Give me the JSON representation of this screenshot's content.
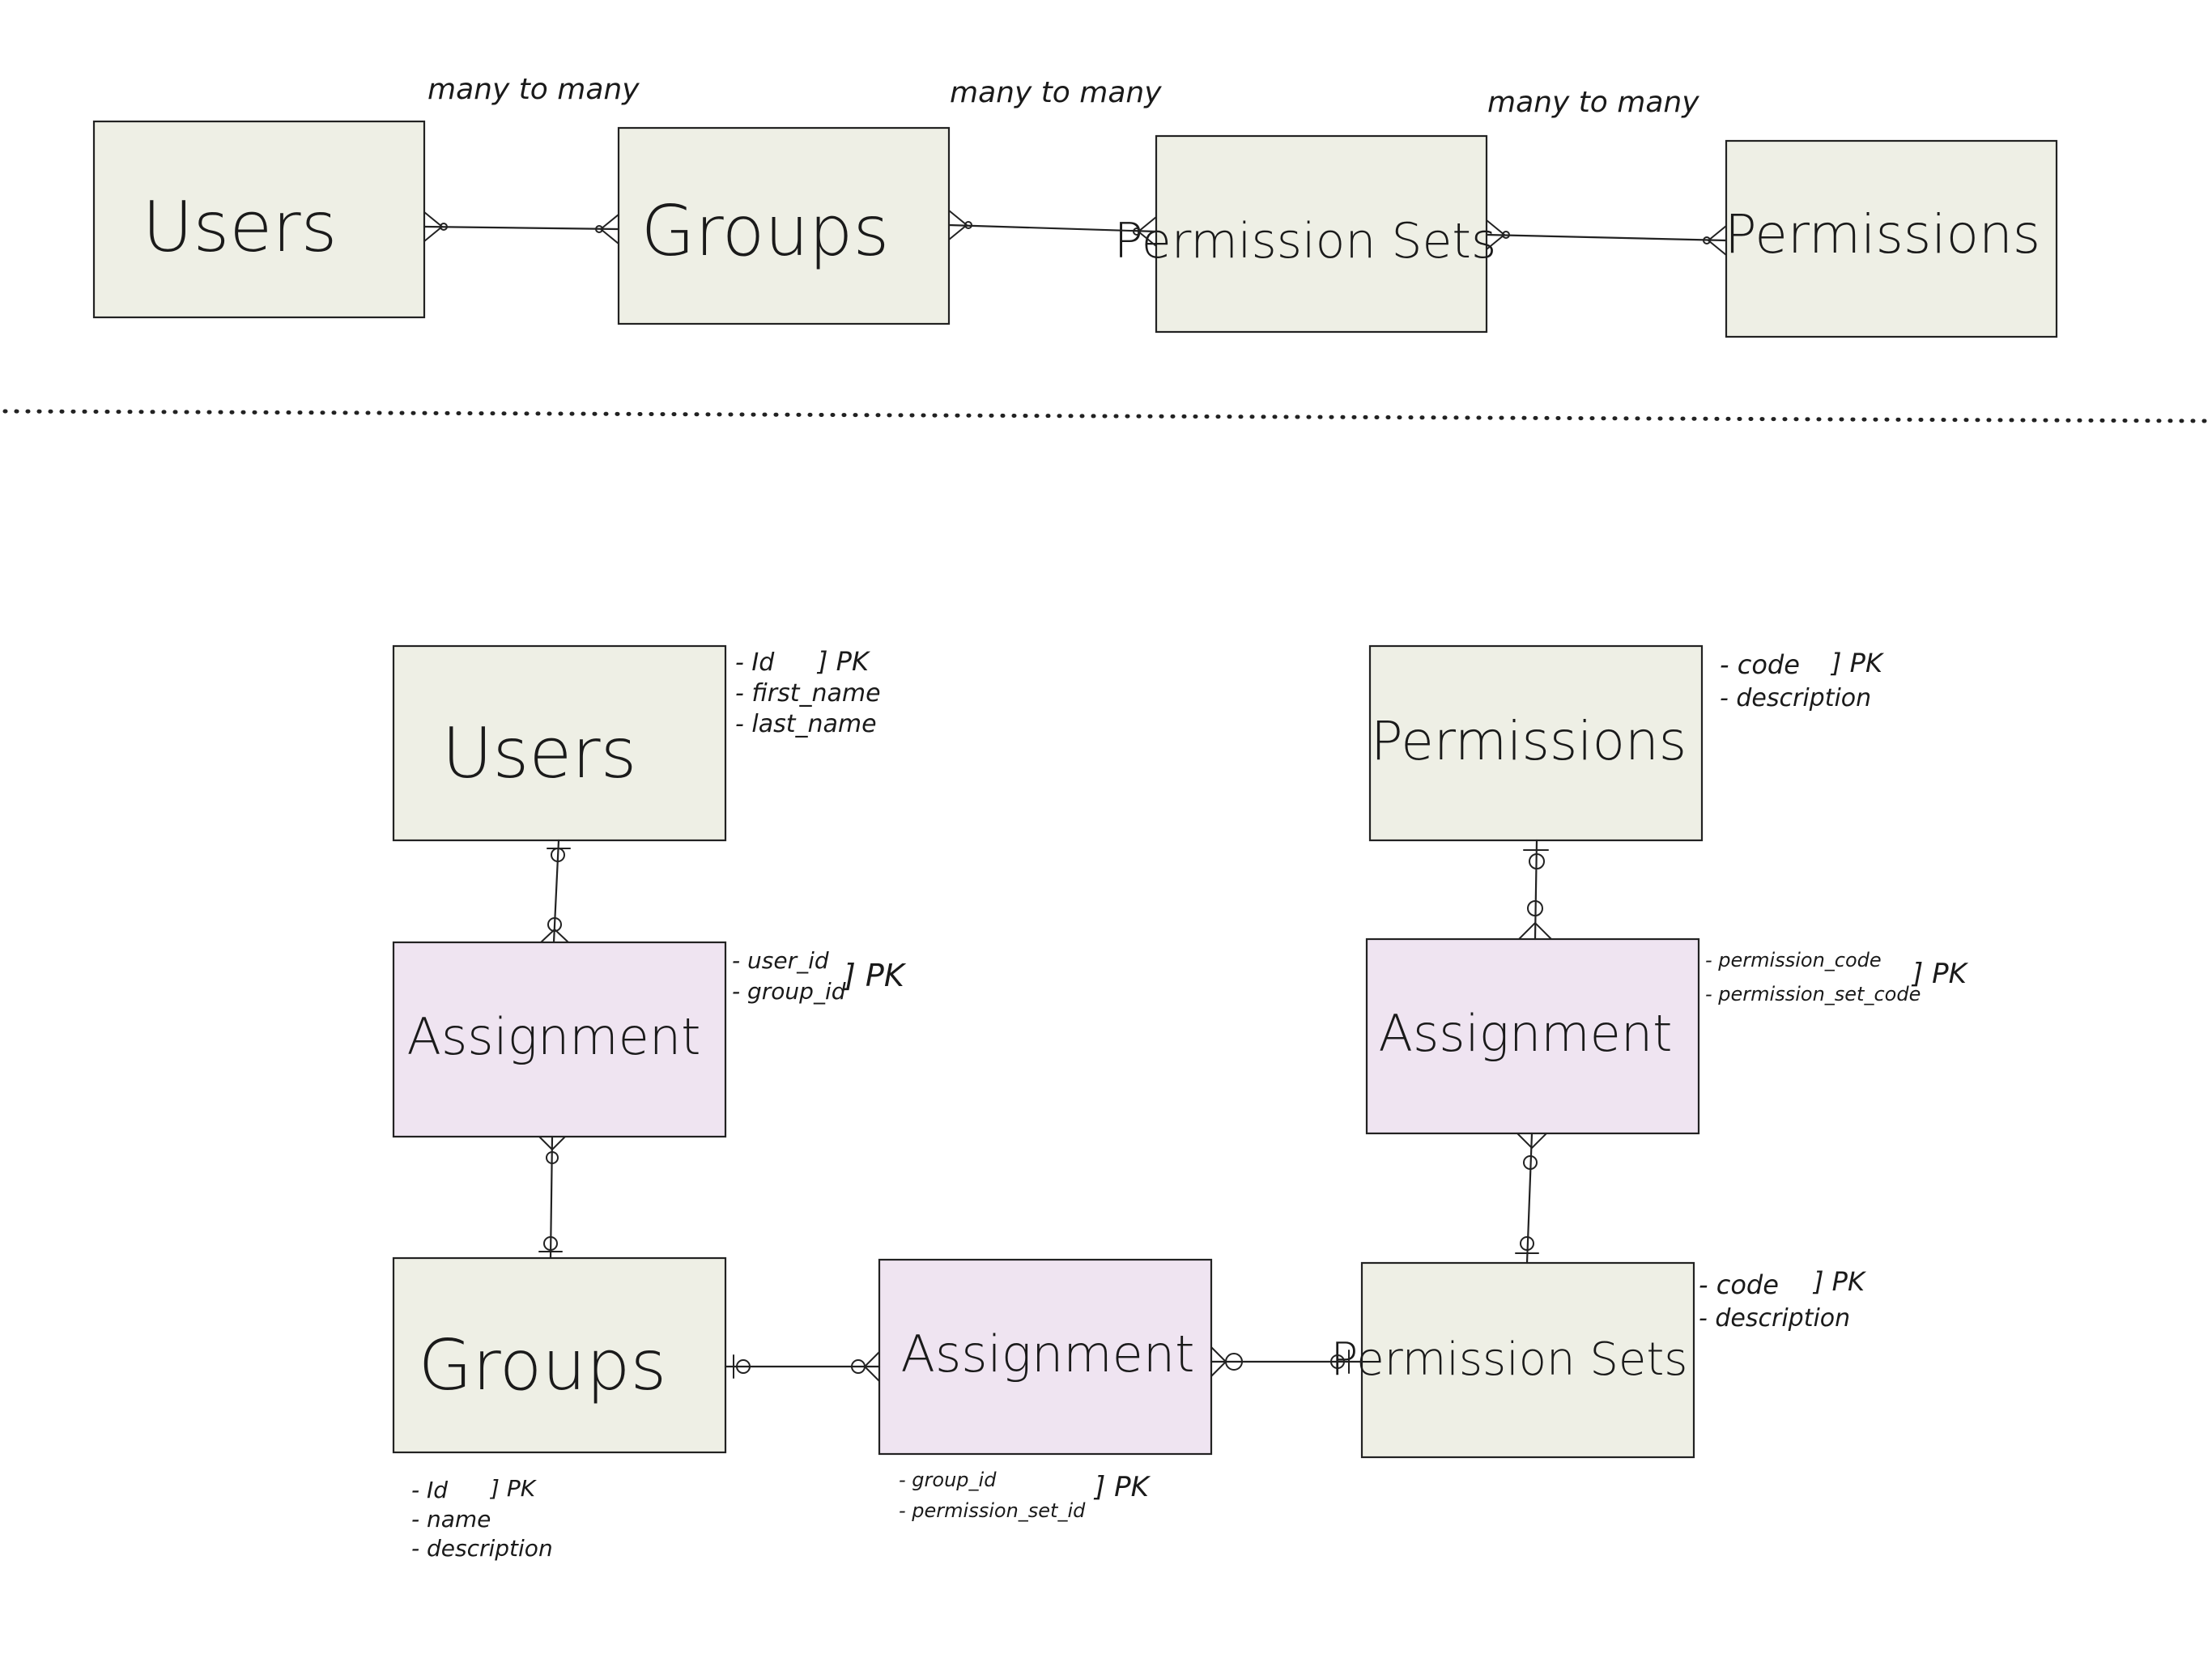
{
  "overview": {
    "entities": [
      "Users",
      "Groups",
      "Permission Sets",
      "Permissions"
    ],
    "relationship_labels": [
      "many to many",
      "many to many",
      "many to many"
    ]
  },
  "detail": {
    "users": {
      "title": "Users",
      "fields": [
        "- Id",
        "- first_name",
        "- last_name"
      ],
      "pk": "] PK"
    },
    "permissions": {
      "title": "Permissions",
      "fields": [
        "- code",
        "- description"
      ],
      "pk": "] PK"
    },
    "user_group_assignment": {
      "title": "Assignment",
      "fields": [
        "- user_id",
        "- group_id"
      ],
      "pk": "] PK"
    },
    "permission_assignment": {
      "title": "Assignment",
      "fields": [
        "- permission_code",
        "- permission_set_code"
      ],
      "pk": "] PK"
    },
    "groups": {
      "title": "Groups",
      "fields": [
        "- Id",
        "- name",
        "- description"
      ],
      "pk": "] PK"
    },
    "group_permissionset_assignment": {
      "title": "Assignment",
      "fields": [
        "- group_id",
        "- permission_set_id"
      ],
      "pk": "] PK"
    },
    "permission_sets": {
      "title": "Permission Sets",
      "fields": [
        "- code",
        "- description"
      ],
      "pk": "] PK"
    }
  },
  "colors": {
    "entity_fill": "#eeefe5",
    "assignment_fill": "#efe4f1",
    "line": "#222222"
  }
}
